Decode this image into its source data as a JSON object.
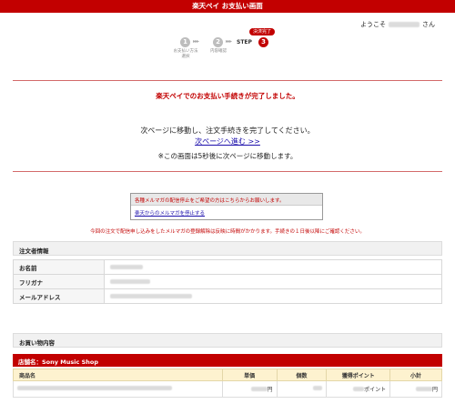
{
  "header": {
    "title": "楽天ペイ お支払い画面"
  },
  "welcome": {
    "prefix": "ようこそ",
    "suffix": "さん"
  },
  "steps": {
    "items": [
      {
        "number": "1",
        "caption": "お支払い方法\n選択"
      },
      {
        "number": "2",
        "caption": "内容確認"
      },
      {
        "number": "3",
        "caption": ""
      }
    ],
    "arrows": "▸▸▸",
    "step_word": "STEP",
    "current_badge": "決済完了"
  },
  "message": {
    "done": "楽天ペイでのお支払い手続きが完了しました。",
    "next": "次ページに移動し、注文手続きを完了してください。",
    "next_link": "次ページへ進む >>",
    "auto": "※この画面は5秒後に次ページに移動します。"
  },
  "mail": {
    "info": "各種メルマガの配信停止をご希望の方はこちらからお願いします。",
    "stop_link": "楽天からのメルマガを停止する",
    "note": "今回の注文で配信申し込みをしたメルマガの登録解除は反映に時間がかかります。手続きの１日後以降にご確認ください。"
  },
  "orderer": {
    "title": "注文者情報",
    "rows": [
      {
        "label": "お名前"
      },
      {
        "label": "フリガナ"
      },
      {
        "label": "メールアドレス"
      }
    ]
  },
  "purchase": {
    "title": "お買い物内容",
    "shop_label": "店舗名：Sony Music Shop",
    "columns": [
      "商品名",
      "単価",
      "個数",
      "獲得ポイント",
      "小計"
    ],
    "row": {
      "price_unit": "円",
      "point_unit": "ポイント",
      "subtotal_unit": "円"
    }
  },
  "colors": {
    "accent": "#c20000",
    "link": "#1a0dab",
    "table_header": "#fdf2cf"
  }
}
